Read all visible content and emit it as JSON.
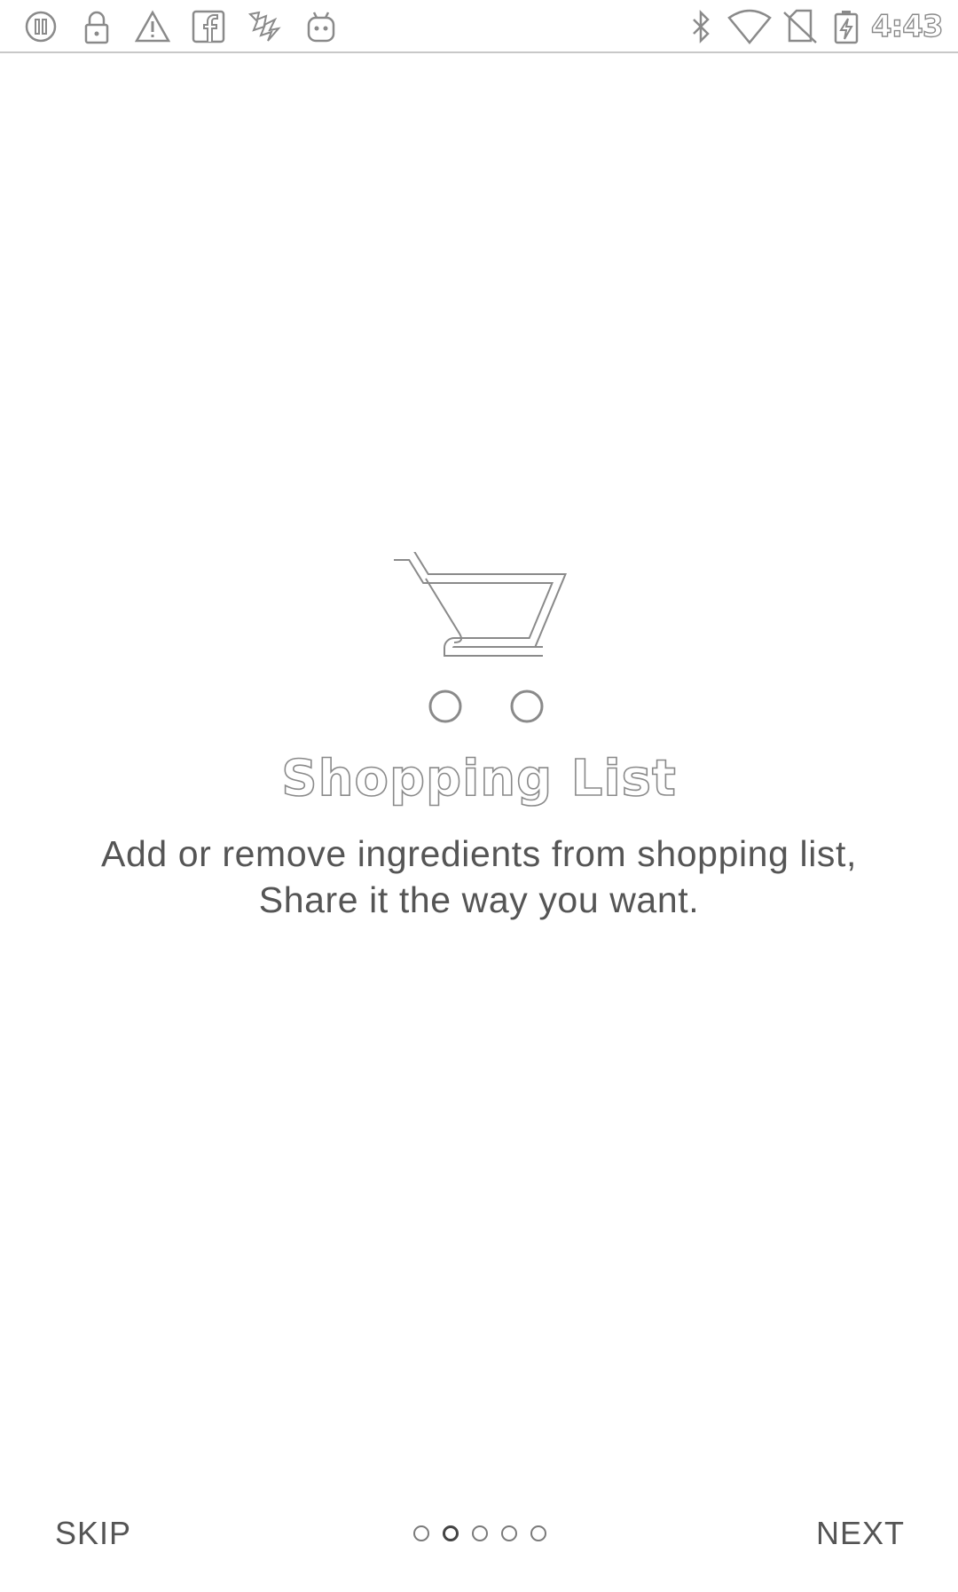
{
  "status_bar": {
    "time": "4:43",
    "left_icons": [
      "sync-icon",
      "lock-icon",
      "warning-icon",
      "facebook-icon",
      "app-icon",
      "android-icon"
    ],
    "right_icons": [
      "bluetooth-icon",
      "wifi-icon",
      "no-sim-icon",
      "battery-charging-icon"
    ]
  },
  "onboarding": {
    "icon": "shopping-cart-icon",
    "title": "Shopping List",
    "description": "Add or remove ingredients from shopping list, Share it the way you want."
  },
  "navigation": {
    "skip_label": "SKIP",
    "next_label": "NEXT",
    "page_count": 5,
    "active_page": 2
  },
  "colors": {
    "background": "#ffffff",
    "text": "#555555",
    "outline": "#8a8a8a"
  }
}
